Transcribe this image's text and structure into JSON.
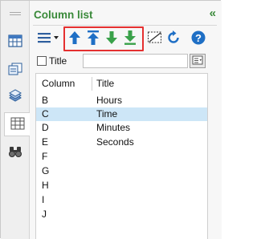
{
  "panel": {
    "title": "Column list",
    "collapse_glyph": "«"
  },
  "colors": {
    "accent_green": "#3a8a3a",
    "highlight_red": "#e53030",
    "selection_blue": "#cde6f7",
    "arrow_blue": "#1f6fc5"
  },
  "rail": {
    "items": [
      {
        "name": "navigation-pane-icon",
        "active": false
      },
      {
        "name": "workbook-sheet-icon",
        "active": false
      },
      {
        "name": "autotext-icon",
        "active": false
      },
      {
        "name": "column-list-icon",
        "active": true
      },
      {
        "name": "find-replace-icon",
        "active": false
      }
    ]
  },
  "toolbar": {
    "items": [
      "menu-icon",
      "move-up-icon",
      "move-to-top-icon",
      "move-down-icon",
      "move-to-bottom-icon",
      "toggle-hidden-icon",
      "refresh-icon",
      "help-icon"
    ],
    "help_glyph": "?"
  },
  "filter": {
    "checkbox_label": "Title",
    "value": ""
  },
  "list": {
    "headers": {
      "column": "Column",
      "title": "Title"
    },
    "rows": [
      {
        "column": "B",
        "title": "Hours",
        "selected": false
      },
      {
        "column": "C",
        "title": "Time",
        "selected": true
      },
      {
        "column": "D",
        "title": "Minutes",
        "selected": false
      },
      {
        "column": "E",
        "title": "Seconds",
        "selected": false
      },
      {
        "column": "F",
        "title": "",
        "selected": false
      },
      {
        "column": "G",
        "title": "",
        "selected": false
      },
      {
        "column": "H",
        "title": "",
        "selected": false
      },
      {
        "column": "I",
        "title": "",
        "selected": false
      },
      {
        "column": "J",
        "title": "",
        "selected": false
      }
    ]
  }
}
